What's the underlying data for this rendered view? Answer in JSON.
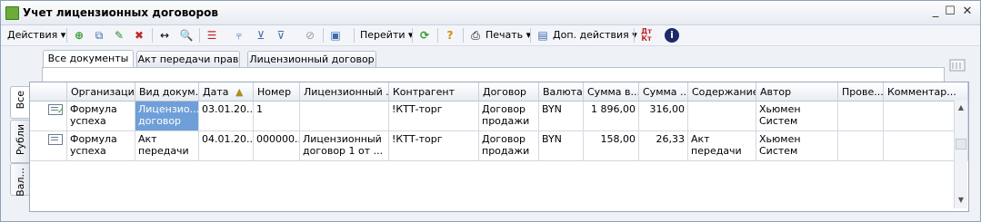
{
  "window": {
    "title": "Учет лицензионных договоров",
    "min": "_",
    "max": "☐",
    "close": "✕"
  },
  "toolbar": {
    "actions_label": "Действия",
    "goto_label": "Перейти",
    "print_label": "Печать",
    "more_actions_label": "Доп. действия"
  },
  "tabs": [
    "Все документы",
    "Акт передачи прав",
    "Лицензионный договор"
  ],
  "side_tabs": [
    "Все",
    "Рубли",
    "Вал..."
  ],
  "table": {
    "headers": [
      "Организация",
      "Вид докум...",
      "Дата",
      "Номер",
      "Лицензионный ...",
      "Контрагент",
      "Договор",
      "Валюта",
      "Сумма в...",
      "Сумма ...",
      "Содержание",
      "Автор",
      "Прове...",
      "Комментар..."
    ],
    "rows": [
      {
        "org": "Формула успеха",
        "doctype": "Лицензио... договор",
        "date": "03.01.20...",
        "number": "1",
        "license": "",
        "contractor": "!КТТ-торг",
        "contract": "Договор продажи ...",
        "currency": "BYN",
        "sum1": "1 896,00",
        "sum2": "316,00",
        "content": "",
        "author": "Хьюмен Систем",
        "checked": "",
        "comment": ""
      },
      {
        "org": "Формула успеха",
        "doctype": "Акт передачи ...",
        "date": "04.01.20...",
        "number": "000000...",
        "license": "Лицензионный договор 1 от ...",
        "contractor": "!КТТ-торг",
        "contract": "Договор продажи ...",
        "currency": "BYN",
        "sum1": "158,00",
        "sum2": "26,33",
        "content": "Акт передачи ...",
        "author": "Хьюмен Систем",
        "checked": "",
        "comment": ""
      }
    ]
  }
}
